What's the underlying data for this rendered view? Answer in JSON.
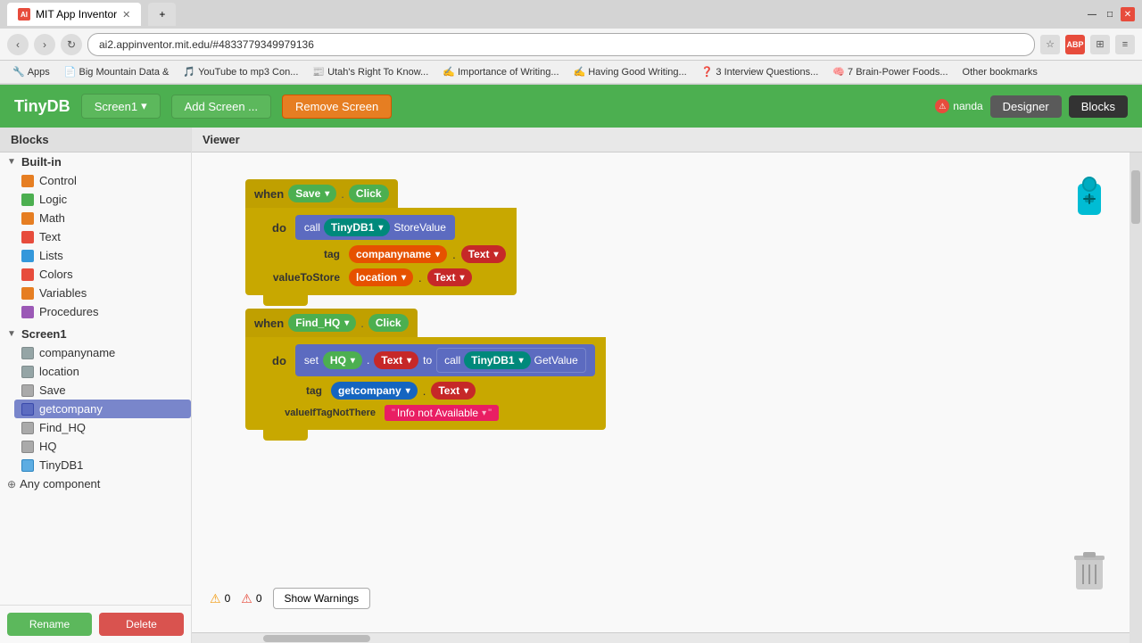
{
  "browser": {
    "tab_title": "MIT App Inventor",
    "tab_icon": "AI",
    "url": "ai2.appinventor.mit.edu/#4833779349979136",
    "bookmarks": [
      {
        "label": "Apps",
        "icon": "🔧"
      },
      {
        "label": "Big Mountain Data &",
        "icon": "📄"
      },
      {
        "label": "YouTube to mp3 Con...",
        "icon": "🎵"
      },
      {
        "label": "Utah's Right To Know...",
        "icon": "📰"
      },
      {
        "label": "Importance of Writing...",
        "icon": "✍"
      },
      {
        "label": "Having Good Writing...",
        "icon": "✍"
      },
      {
        "label": "3 Interview Questions...",
        "icon": "❓"
      },
      {
        "label": "7 Brain-Power Foods...",
        "icon": "🧠"
      }
    ],
    "other_bookmarks": "Other bookmarks"
  },
  "app": {
    "title": "TinyDB",
    "screen_label": "Screen1",
    "add_screen": "Add Screen ...",
    "remove_screen": "Remove Screen",
    "designer_btn": "Designer",
    "blocks_btn": "Blocks",
    "user": "nanda"
  },
  "sidebar": {
    "header": "Blocks",
    "builtin_label": "Built-in",
    "builtin_items": [
      {
        "label": "Control",
        "color": "#e67e22"
      },
      {
        "label": "Logic",
        "color": "#4CAF50"
      },
      {
        "label": "Math",
        "color": "#e67e22"
      },
      {
        "label": "Text",
        "color": "#e74c3c"
      },
      {
        "label": "Lists",
        "color": "#3498db"
      },
      {
        "label": "Colors",
        "color": "#e74c3c"
      },
      {
        "label": "Variables",
        "color": "#e67e22"
      },
      {
        "label": "Procedures",
        "color": "#9b59b6"
      }
    ],
    "screen1_label": "Screen1",
    "screen1_items": [
      {
        "label": "companyname",
        "icon": "📝"
      },
      {
        "label": "location",
        "icon": "📝"
      },
      {
        "label": "Save",
        "icon": "🔘"
      },
      {
        "label": "getcompany",
        "icon": "🔘",
        "selected": true
      },
      {
        "label": "Find_HQ",
        "icon": "🔘"
      },
      {
        "label": "HQ",
        "icon": "🔘"
      },
      {
        "label": "TinyDB1",
        "icon": "🗄"
      }
    ],
    "any_component": "Any component",
    "rename_btn": "Rename",
    "delete_btn": "Delete"
  },
  "viewer": {
    "header": "Viewer",
    "block1": {
      "when": "when",
      "component": "Save",
      "event": "Click",
      "do": "do",
      "call": "call",
      "db": "TinyDB1",
      "method": "StoreValue",
      "tag_label": "tag",
      "tag_component": "companyname",
      "tag_dot": ".",
      "tag_prop": "Text",
      "value_label": "valueToStore",
      "value_component": "location",
      "value_dot": ".",
      "value_prop": "Text"
    },
    "block2": {
      "when": "when",
      "component": "Find_HQ",
      "event": "Click",
      "do": "do",
      "set": "set",
      "set_component": "HQ",
      "set_dot": ".",
      "set_prop": "Text",
      "to": "to",
      "call": "call",
      "db": "TinyDB1",
      "method": "GetValue",
      "tag_label": "tag",
      "tag_component": "getcompany",
      "tag_dot": ".",
      "tag_prop": "Text",
      "value_label": "valueIfTagNotThere",
      "value_string": "Info not Available"
    },
    "warnings": {
      "warn_count": "0",
      "error_count": "0",
      "show_warnings_btn": "Show Warnings"
    }
  }
}
